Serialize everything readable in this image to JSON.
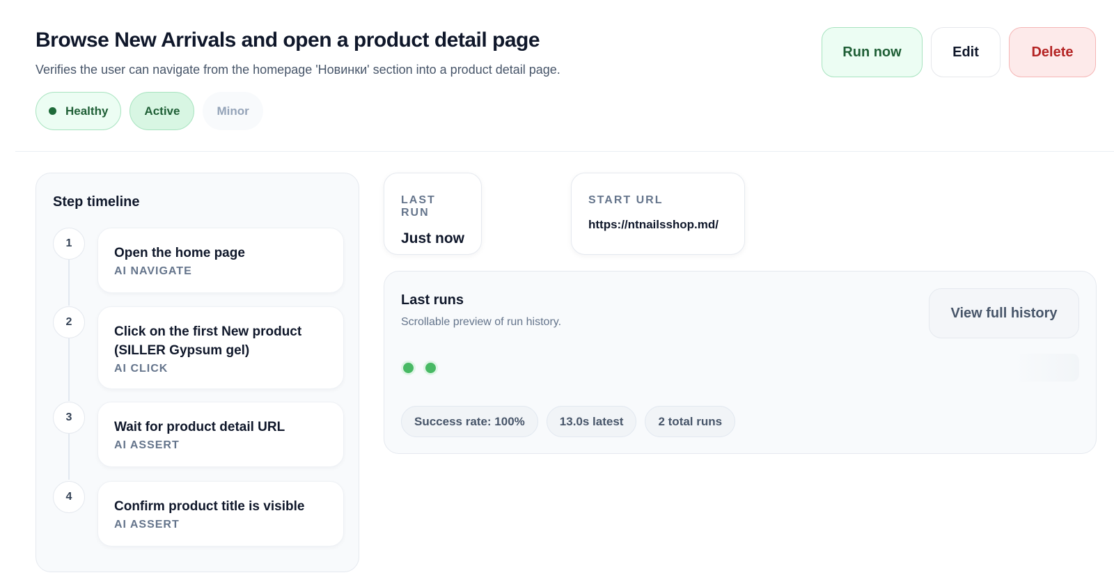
{
  "header": {
    "title": "Browse New Arrivals and open a product detail page",
    "subtitle": "Verifies the user can navigate from the homepage 'Новинки' section into a product detail page.",
    "badges": {
      "health": "Healthy",
      "state": "Active",
      "severity": "Minor"
    }
  },
  "actions": {
    "run_label": "Run now",
    "edit_label": "Edit",
    "delete_label": "Delete"
  },
  "timeline": {
    "title": "Step timeline",
    "steps": [
      {
        "number": "1",
        "text": "Open the home page",
        "type": "AI NAVIGATE"
      },
      {
        "number": "2",
        "text": "Click on the first New product (SILLER Gypsum gel)",
        "type": "AI CLICK"
      },
      {
        "number": "3",
        "text": "Wait for product detail URL",
        "type": "AI ASSERT"
      },
      {
        "number": "4",
        "text": "Confirm product title is visible",
        "type": "AI ASSERT"
      }
    ]
  },
  "stats": {
    "last_run": {
      "label": "LAST RUN",
      "value": "Just now"
    },
    "start_url": {
      "label": "START URL",
      "value": "https://ntnailsshop.md/"
    }
  },
  "runs": {
    "title": "Last runs",
    "subtitle": "Scrollable preview of run history.",
    "history_button": "View full history",
    "results": [
      "pass",
      "pass"
    ],
    "chips": {
      "success_rate": "Success rate: 100%",
      "latest": "13.0s latest",
      "total": "2 total runs"
    }
  },
  "colors": {
    "success": "#48b964",
    "danger": "#b42323",
    "healthy_text": "#1f5f36"
  }
}
